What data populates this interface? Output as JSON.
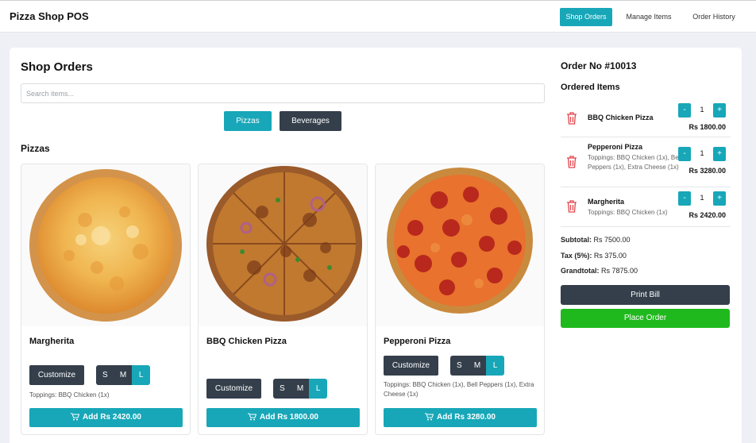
{
  "app": {
    "title": "Pizza Shop POS"
  },
  "nav": {
    "items": [
      {
        "label": "Shop Orders"
      },
      {
        "label": "Manage Items"
      },
      {
        "label": "Order History"
      }
    ]
  },
  "main": {
    "title": "Shop Orders",
    "search_placeholder": "Search items...",
    "categories": [
      {
        "label": "Pizzas"
      },
      {
        "label": "Beverages"
      }
    ],
    "section_title": "Pizzas",
    "products": [
      {
        "name": "Margherita",
        "customize_label": "Customize",
        "sizes": [
          "S",
          "M",
          "L"
        ],
        "selected_size": "L",
        "toppings": "Toppings: BBQ Chicken (1x)",
        "add_label": "Add Rs 2420.00"
      },
      {
        "name": "BBQ Chicken Pizza",
        "customize_label": "Customize",
        "sizes": [
          "S",
          "M",
          "L"
        ],
        "selected_size": "L",
        "toppings": "",
        "add_label": "Add Rs 1800.00"
      },
      {
        "name": "Pepperoni Pizza",
        "customize_label": "Customize",
        "sizes": [
          "S",
          "M",
          "L"
        ],
        "selected_size": "L",
        "toppings": "Toppings: BBQ Chicken (1x), Bell Peppers (1x), Extra Cheese (1x)",
        "add_label": "Add Rs 3280.00"
      }
    ]
  },
  "order": {
    "title": "Order No #10013",
    "items_title": "Ordered Items",
    "items": [
      {
        "name": "BBQ Chicken Pizza",
        "toppings": "",
        "qty": "1",
        "minus": "-",
        "plus": "+",
        "price": "Rs 1800.00"
      },
      {
        "name": "Pepperoni Pizza",
        "toppings": "Toppings: BBQ Chicken (1x), Bell Peppers (1x), Extra Cheese (1x)",
        "qty": "1",
        "minus": "-",
        "plus": "+",
        "price": "Rs 3280.00"
      },
      {
        "name": "Margherita",
        "toppings": "Toppings: BBQ Chicken (1x)",
        "qty": "1",
        "minus": "-",
        "plus": "+",
        "price": "Rs 2420.00"
      }
    ],
    "subtotal_label": "Subtotal:",
    "subtotal_value": "Rs 7500.00",
    "tax_label": "Tax (5%):",
    "tax_value": "Rs 375.00",
    "grand_label": "Grandtotal:",
    "grand_value": "Rs 7875.00",
    "print_label": "Print Bill",
    "place_label": "Place Order"
  },
  "colors": {
    "accent": "#17a7b8",
    "dark": "#343f4b",
    "success": "#20b91d",
    "danger": "#e0464c"
  }
}
